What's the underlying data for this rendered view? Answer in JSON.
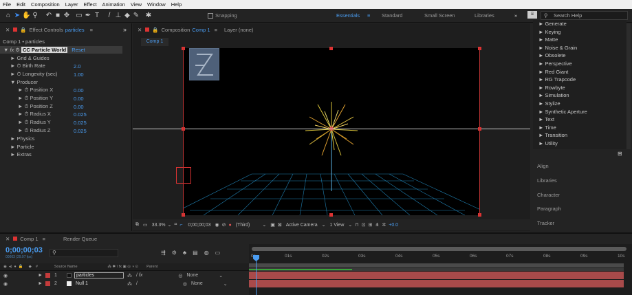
{
  "menu": [
    "File",
    "Edit",
    "Composition",
    "Layer",
    "Effect",
    "Animation",
    "View",
    "Window",
    "Help"
  ],
  "toolbar": {
    "snapping": "Snapping"
  },
  "workspaces": {
    "essentials": "Essentials",
    "standard": "Standard",
    "small_screen": "Small Screen",
    "libraries": "Libraries"
  },
  "search": {
    "placeholder": "Search Help"
  },
  "effect_controls": {
    "tab": "Effect Controls",
    "layer": "particles",
    "breadcrumb": "Comp 1 • particles",
    "effect_name": "CC Particle World",
    "reset": "Reset",
    "grid_guides": "Grid & Guides",
    "birth_rate_label": "Birth Rate",
    "birth_rate": "2.0",
    "longevity_label": "Longevity (sec)",
    "longevity": "1.00",
    "producer": "Producer",
    "pos_x_label": "Position X",
    "pos_x": "0.00",
    "pos_y_label": "Position Y",
    "pos_y": "0.00",
    "pos_z_label": "Position Z",
    "pos_z": "0.00",
    "rad_x_label": "Radius X",
    "rad_x": "0.025",
    "rad_y_label": "Radius Y",
    "rad_y": "0.025",
    "rad_z_label": "Radius Z",
    "rad_z": "0.025",
    "physics": "Physics",
    "particle": "Particle",
    "extras": "Extras"
  },
  "composition": {
    "tab": "Composition",
    "comp": "Comp 1",
    "layer": "Layer (none)",
    "subtab": "Comp 1"
  },
  "viewer_bar": {
    "zoom": "33.3%",
    "time": "0;00;00;03",
    "resolution": "(Third)",
    "camera": "Active Camera",
    "view": "1 View",
    "exposure": "+0.0"
  },
  "effects_list": [
    "Generate",
    "Keying",
    "Matte",
    "Noise & Grain",
    "Obsolete",
    "Perspective",
    "Red Giant",
    "RG Trapcode",
    "Rowbyte",
    "Simulation",
    "Stylize",
    "Synthetic Aperture",
    "Text",
    "Time",
    "Transition",
    "Utility"
  ],
  "right_panels": [
    "Align",
    "Libraries",
    "Character",
    "Paragraph",
    "Tracker"
  ],
  "timeline": {
    "tab": "Comp 1",
    "render_queue": "Render Queue",
    "timecode": "0;00;00;03",
    "fps": "00003 (29.97 fps)",
    "col_source": "Source Name",
    "col_parent": "Parent",
    "layers": [
      {
        "num": "1",
        "name": "particles",
        "parent": "None",
        "color": "#c43b3b"
      },
      {
        "num": "2",
        "name": "Null 1",
        "parent": "None",
        "color": "#c43b3b"
      }
    ],
    "ticks": [
      "0s",
      "01s",
      "02s",
      "03s",
      "04s",
      "05s",
      "06s",
      "07s",
      "08s",
      "09s",
      "10s"
    ]
  },
  "colors": {
    "accent": "#3f8ef5",
    "label_red": "#c43b3b",
    "track": "#a84a4a"
  }
}
